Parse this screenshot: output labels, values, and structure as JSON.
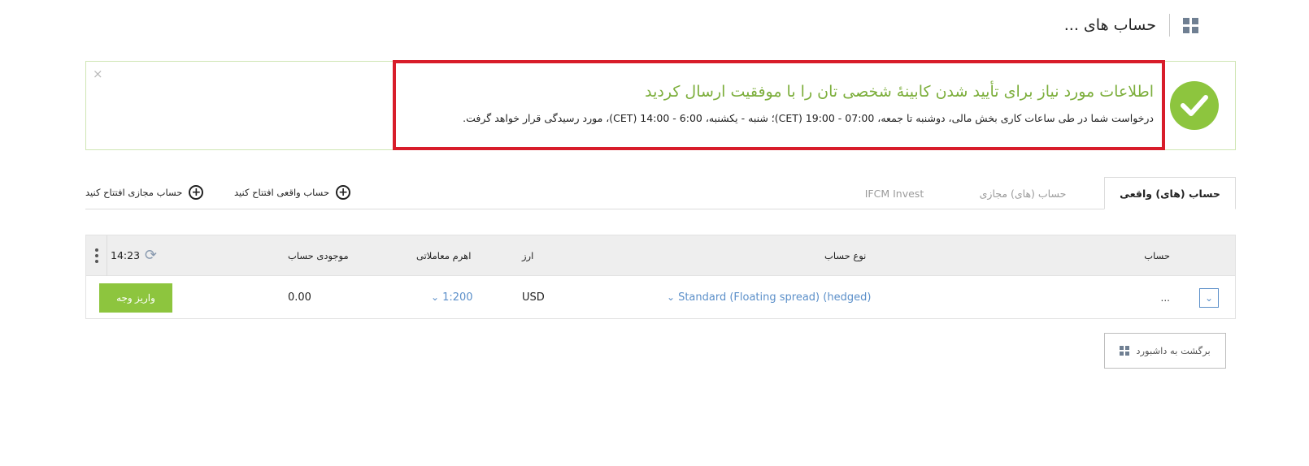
{
  "header": {
    "title": "حساب های ...",
    "icon": "dashboard-grid-icon"
  },
  "banner": {
    "title": "اطلاعات مورد نیاز برای تأیید شدن کابینهٔ شخصی تان را با موفقیت ارسال کردید",
    "text": "درخواست شما در طی ساعات کاری بخش مالی، دوشنبه تا جمعه، 07:00 - 19:00 (CET)؛ شنبه - یکشنبه، 6:00 - 14:00 (CET)، مورد رسیدگی قرار خواهد گرفت.",
    "close_label": "×",
    "check_color": "#8dc53e",
    "highlight_color": "#d81d2a"
  },
  "tabs": [
    {
      "label": "حساب (های) واقعی",
      "active": true
    },
    {
      "label": "حساب (های) مجازی",
      "active": false
    },
    {
      "label": "IFCM Invest",
      "active": false
    }
  ],
  "actions": {
    "open_real": "حساب واقعی افتتاح کنید",
    "open_demo": "حساب مجازی افتتاح کنید"
  },
  "table": {
    "headers": {
      "account": "حساب",
      "account_type": "نوع حساب",
      "currency": "ارز",
      "leverage": "اهرم معاملاتی",
      "balance": "موجودی حساب"
    },
    "time": "14:23",
    "rows": [
      {
        "account": ".‏‏..",
        "account_type": "Standard (Floating spread) (hedged)",
        "currency": "USD",
        "leverage": "1:200",
        "balance": "0.00",
        "deposit_label": "واریز وجه"
      }
    ]
  },
  "back_button": {
    "label": "برگشت به داشبورد"
  },
  "colors": {
    "accent_green": "#8dc53e",
    "link_blue": "#5b8fc9"
  }
}
